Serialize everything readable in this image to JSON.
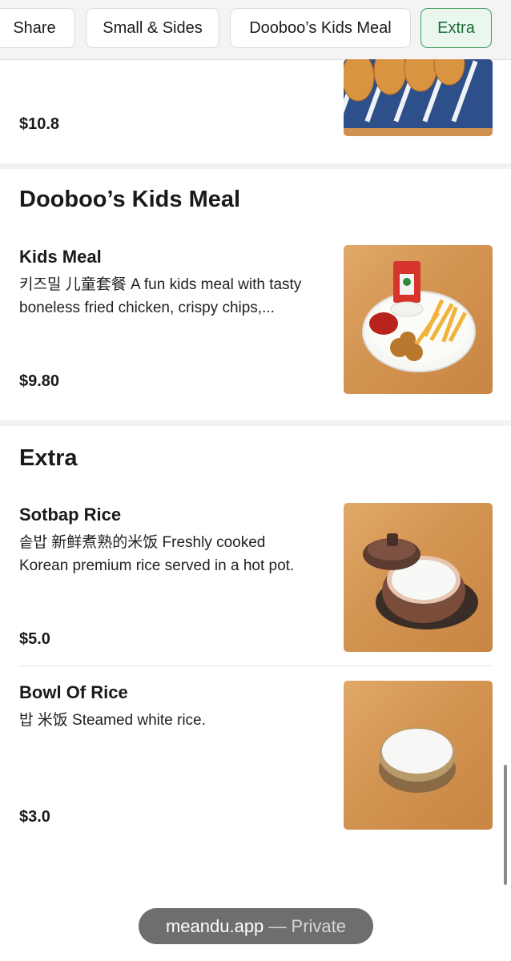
{
  "tabs": [
    {
      "label": "Share"
    },
    {
      "label": "Small & Sides"
    },
    {
      "label": "Dooboo’s Kids Meal"
    },
    {
      "label": "Extra",
      "active": true
    }
  ],
  "previous_item": {
    "price": "$10.8"
  },
  "sections": [
    {
      "title": "Dooboo’s Kids Meal",
      "items": [
        {
          "name": "Kids Meal",
          "description_line1": "키즈밀 儿童套餐 A fun kids meal with tasty",
          "description_line2": "boneless fried chicken, crispy chips,...",
          "price": "$9.80",
          "image": "kids-meal-plate"
        }
      ]
    },
    {
      "title": "Extra",
      "items": [
        {
          "name": "Sotbap Rice",
          "description_line1": "솥밥 新鲜煮熟的米饭 Freshly cooked",
          "description_line2": "Korean premium rice served in a hot pot.",
          "price": "$5.0",
          "image": "rice-hot-pot"
        },
        {
          "name": "Bowl Of Rice",
          "description_line1": "밥 米饭 Steamed white rice.",
          "description_line2": "",
          "price": "$3.0",
          "image": "rice-bowl"
        }
      ]
    }
  ],
  "browser": {
    "domain": "meandu.app",
    "separator": " — ",
    "mode": "Private"
  },
  "colors": {
    "accent_green": "#3f9a5a",
    "active_tab_bg": "#eaf7ee",
    "url_pill_bg": "#6e6e6e"
  }
}
